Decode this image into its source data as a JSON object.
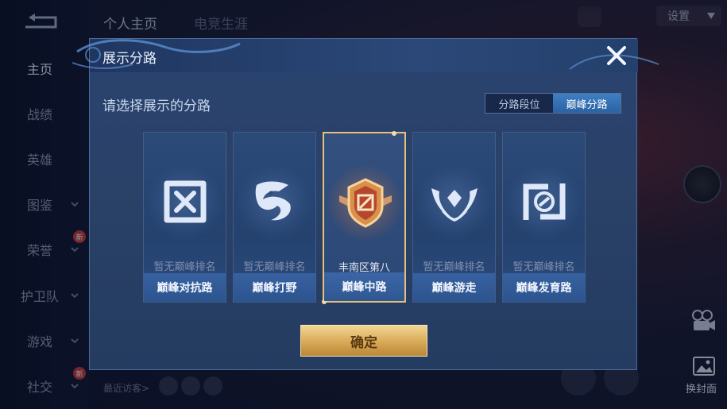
{
  "top_nav": {
    "tabs": [
      "个人主页",
      "电竞生涯"
    ],
    "settings_label": "设置"
  },
  "sidebar": {
    "items": [
      {
        "label": "主页",
        "active": true
      },
      {
        "label": "战绩"
      },
      {
        "label": "英雄"
      },
      {
        "label": "图鉴"
      },
      {
        "label": "荣誉"
      },
      {
        "label": "护卫队"
      },
      {
        "label": "游戏"
      },
      {
        "label": "社交"
      }
    ],
    "badge_new": "新"
  },
  "footer": {
    "recent_visitors": "最近访客>"
  },
  "right": {
    "change_cover_label": "换封面"
  },
  "dialog": {
    "title": "展示分路",
    "subtitle": "请选择展示的分路",
    "segments": [
      "分路段位",
      "巅峰分路"
    ],
    "active_segment": 1,
    "cards": [
      {
        "rank": "暂无巅峰排名",
        "name": "巅峰对抗路",
        "icon": "clash-lane-icon",
        "selected": false
      },
      {
        "rank": "暂无巅峰排名",
        "name": "巅峰打野",
        "icon": "jungle-icon",
        "selected": false
      },
      {
        "rank": "丰南区第八",
        "name": "巅峰中路",
        "icon": "mid-lane-badge-icon",
        "selected": true
      },
      {
        "rank": "暂无巅峰排名",
        "name": "巅峰游走",
        "icon": "roam-icon",
        "selected": false
      },
      {
        "rank": "暂无巅峰排名",
        "name": "巅峰发育路",
        "icon": "farm-lane-icon",
        "selected": false
      }
    ],
    "confirm_label": "确定"
  },
  "colors": {
    "accent_gold": "#e7c07a",
    "card_bar": "#3761a0",
    "segment_active": "#3f7fc4"
  }
}
